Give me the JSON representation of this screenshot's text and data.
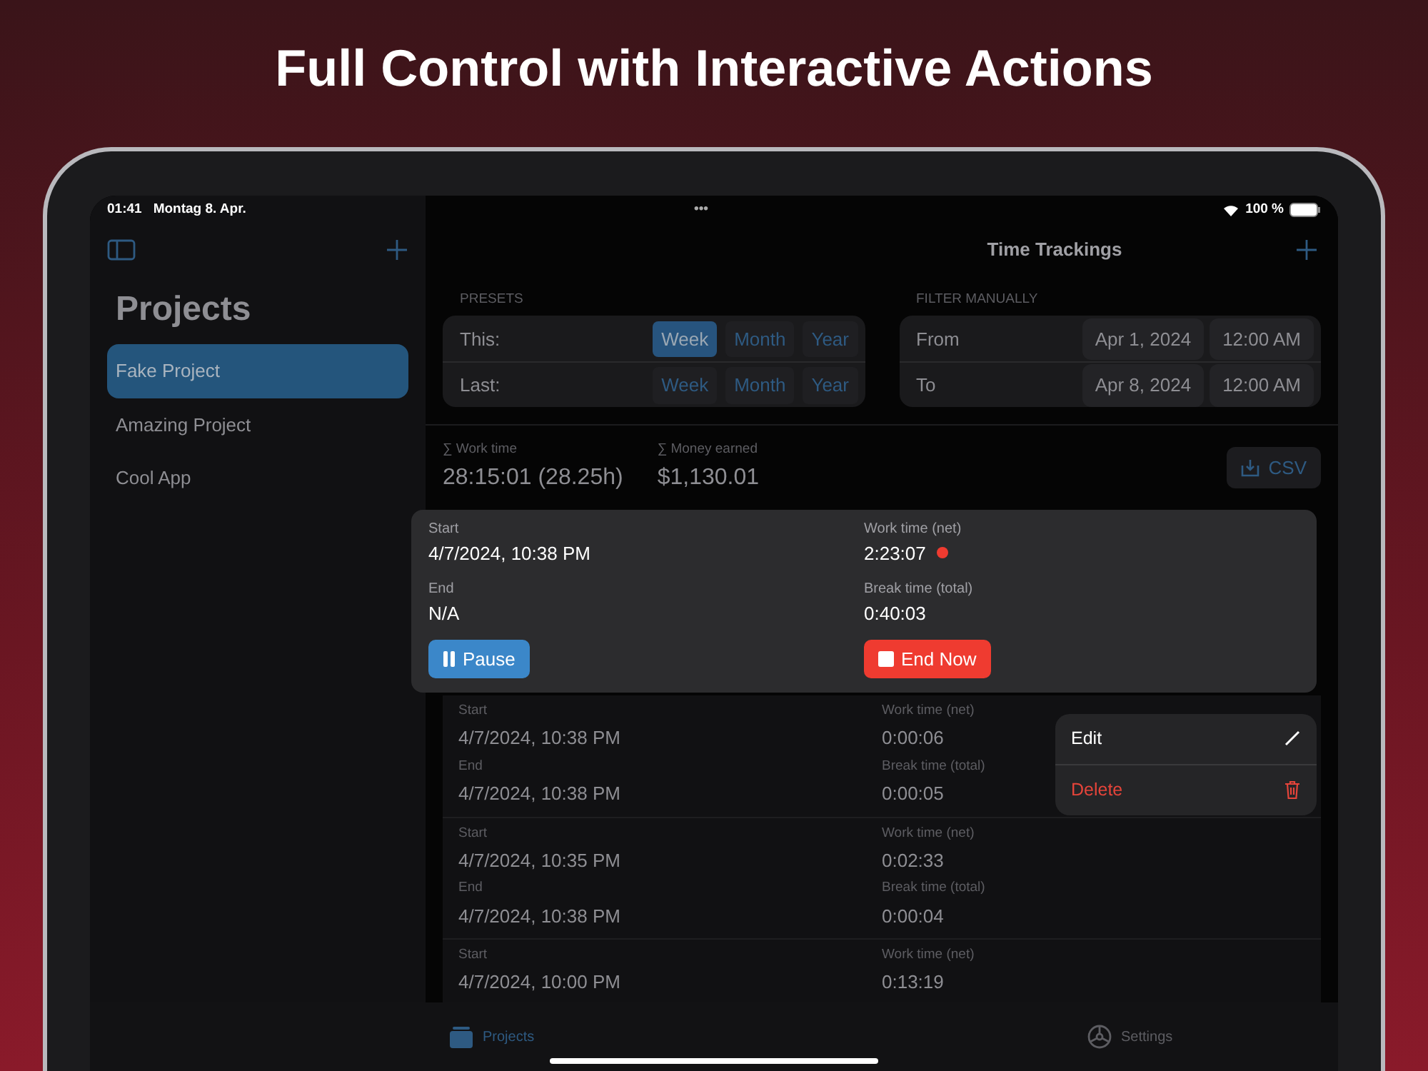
{
  "headline": "Full Control with Interactive Actions",
  "status_bar": {
    "time": "01:41",
    "date": "Montag 8. Apr.",
    "dots": "•••",
    "battery": "100 %"
  },
  "sidebar": {
    "title": "Projects",
    "items": [
      {
        "label": "Fake Project",
        "selected": true
      },
      {
        "label": "Amazing Project",
        "selected": false
      },
      {
        "label": "Cool App",
        "selected": false
      }
    ]
  },
  "main": {
    "title": "Time Trackings"
  },
  "presets": {
    "header": "PRESETS",
    "rows": [
      {
        "label": "This:",
        "options": [
          {
            "label": "Week",
            "selected": true
          },
          {
            "label": "Month",
            "selected": false
          },
          {
            "label": "Year",
            "selected": false
          }
        ]
      },
      {
        "label": "Last:",
        "options": [
          {
            "label": "Week",
            "selected": false
          },
          {
            "label": "Month",
            "selected": false
          },
          {
            "label": "Year",
            "selected": false
          }
        ]
      }
    ]
  },
  "filter": {
    "header": "FILTER MANUALLY",
    "rows": [
      {
        "label": "From",
        "date": "Apr 1, 2024",
        "time": "12:00 AM"
      },
      {
        "label": "To",
        "date": "Apr 8, 2024",
        "time": "12:00 AM"
      }
    ]
  },
  "summary": {
    "items": [
      {
        "label": "∑ Work time",
        "value": "28:15:01 (28.25h)"
      },
      {
        "label": "∑ Money earned",
        "value": "$1,130.01"
      }
    ],
    "export_button": "CSV"
  },
  "active_entry": {
    "running": true,
    "fields": [
      {
        "label": "Start",
        "value": "4/7/2024, 10:38 PM"
      },
      {
        "label": "Work time (net)",
        "value": "2:23:07"
      },
      {
        "label": "End",
        "value": "N/A"
      },
      {
        "label": "Break time (total)",
        "value": "0:40:03"
      }
    ],
    "pause_button": "Pause",
    "end_button": "End Now"
  },
  "entries": [
    {
      "fields": [
        {
          "label": "Start",
          "value": "4/7/2024, 10:38 PM"
        },
        {
          "label": "Work time (net)",
          "value": "0:00:06"
        },
        {
          "label": "End",
          "value": "4/7/2024, 10:38 PM"
        },
        {
          "label": "Break time (total)",
          "value": "0:00:05"
        }
      ]
    },
    {
      "fields": [
        {
          "label": "Start",
          "value": "4/7/2024, 10:35 PM"
        },
        {
          "label": "Work time (net)",
          "value": "0:02:33"
        },
        {
          "label": "End",
          "value": "4/7/2024, 10:38 PM"
        },
        {
          "label": "Break time (total)",
          "value": "0:00:04"
        }
      ]
    },
    {
      "fields": [
        {
          "label": "Start",
          "value": "4/7/2024, 10:00 PM"
        },
        {
          "label": "Work time (net)",
          "value": "0:13:19"
        }
      ]
    }
  ],
  "context_menu": [
    {
      "label": "Edit",
      "kind": "normal"
    },
    {
      "label": "Delete",
      "kind": "destructive"
    }
  ],
  "tab_bar": [
    {
      "label": "Projects",
      "selected": true,
      "kind": "projects"
    },
    {
      "label": "Settings",
      "selected": false,
      "kind": "settings"
    }
  ]
}
